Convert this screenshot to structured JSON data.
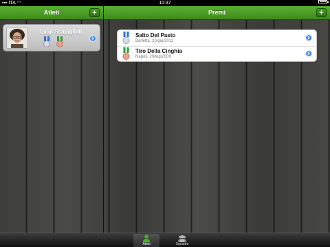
{
  "status_bar": {
    "carrier": "ITA",
    "time": "10:37"
  },
  "left_pane": {
    "title": "Atleti",
    "add_label": "+",
    "athletes": [
      {
        "name": "Luigi Scapigliati"
      }
    ]
  },
  "right_pane": {
    "title": "Premi",
    "add_label": "+",
    "prizes": [
      {
        "title": "Salto Del Pasto",
        "subtitle": "Barletta, 20/giu/2012",
        "medal": "silver"
      },
      {
        "title": "Tiro Della Cinghia",
        "subtitle": "Napoli, 20/lug/2009",
        "medal": "bronze"
      }
    ]
  },
  "tab_bar": {
    "tabs": [
      {
        "label": "Atleti",
        "icon": "person-icon",
        "selected": true
      },
      {
        "label": "Squadre",
        "icon": "team-icon",
        "selected": false
      }
    ]
  },
  "colors": {
    "nav_green": "#4a9c25",
    "disclosure_blue": "#2a6fe0"
  }
}
